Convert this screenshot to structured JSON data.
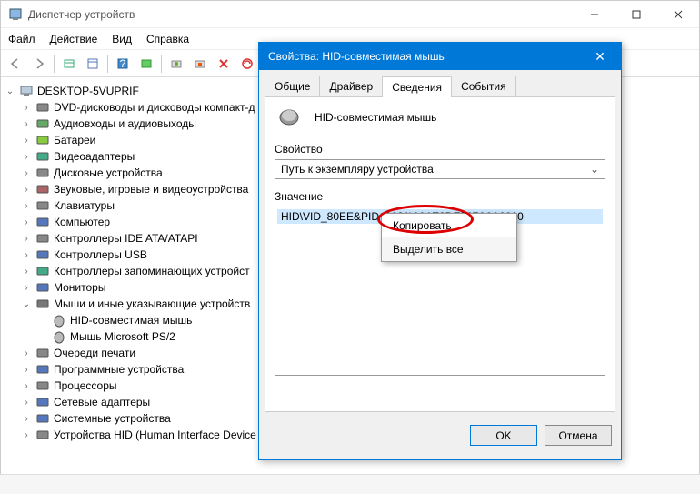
{
  "window": {
    "title": "Диспетчер устройств"
  },
  "menubar": {
    "file": "Файл",
    "action": "Действие",
    "view": "Вид",
    "help": "Справка"
  },
  "tree": {
    "root": "DESKTOP-5VUPRIF",
    "items": [
      "DVD-дисководы и дисководы компакт-д",
      "Аудиовходы и аудиовыходы",
      "Батареи",
      "Видеоадаптеры",
      "Дисковые устройства",
      "Звуковые, игровые и видеоустройства",
      "Клавиатуры",
      "Компьютер",
      "Контроллеры IDE ATA/ATAPI",
      "Контроллеры USB",
      "Контроллеры запоминающих устройст",
      "Мониторы",
      "Мыши и иные указывающие устройств",
      "Очереди печати",
      "Программные устройства",
      "Процессоры",
      "Сетевые адаптеры",
      "Системные устройства",
      "Устройства HID (Human Interface Device"
    ],
    "mice_children": [
      "HID-совместимая мышь",
      "Мышь Microsoft PS/2"
    ]
  },
  "dialog": {
    "title": "Свойства: HID-совместимая мышь",
    "tabs": {
      "general": "Общие",
      "driver": "Драйвер",
      "details": "Сведения",
      "events": "События"
    },
    "device_name": "HID-совместимая мышь",
    "property_label": "Свойство",
    "property_value": "Путь к экземпляру устройства",
    "value_label": "Значение",
    "value_item": "HID\\VID_80EE&PID_0021\\6&1E8DE507&0&0000",
    "context": {
      "copy": "Копировать",
      "select_all": "Выделить все"
    },
    "buttons": {
      "ok": "OK",
      "cancel": "Отмена"
    }
  }
}
